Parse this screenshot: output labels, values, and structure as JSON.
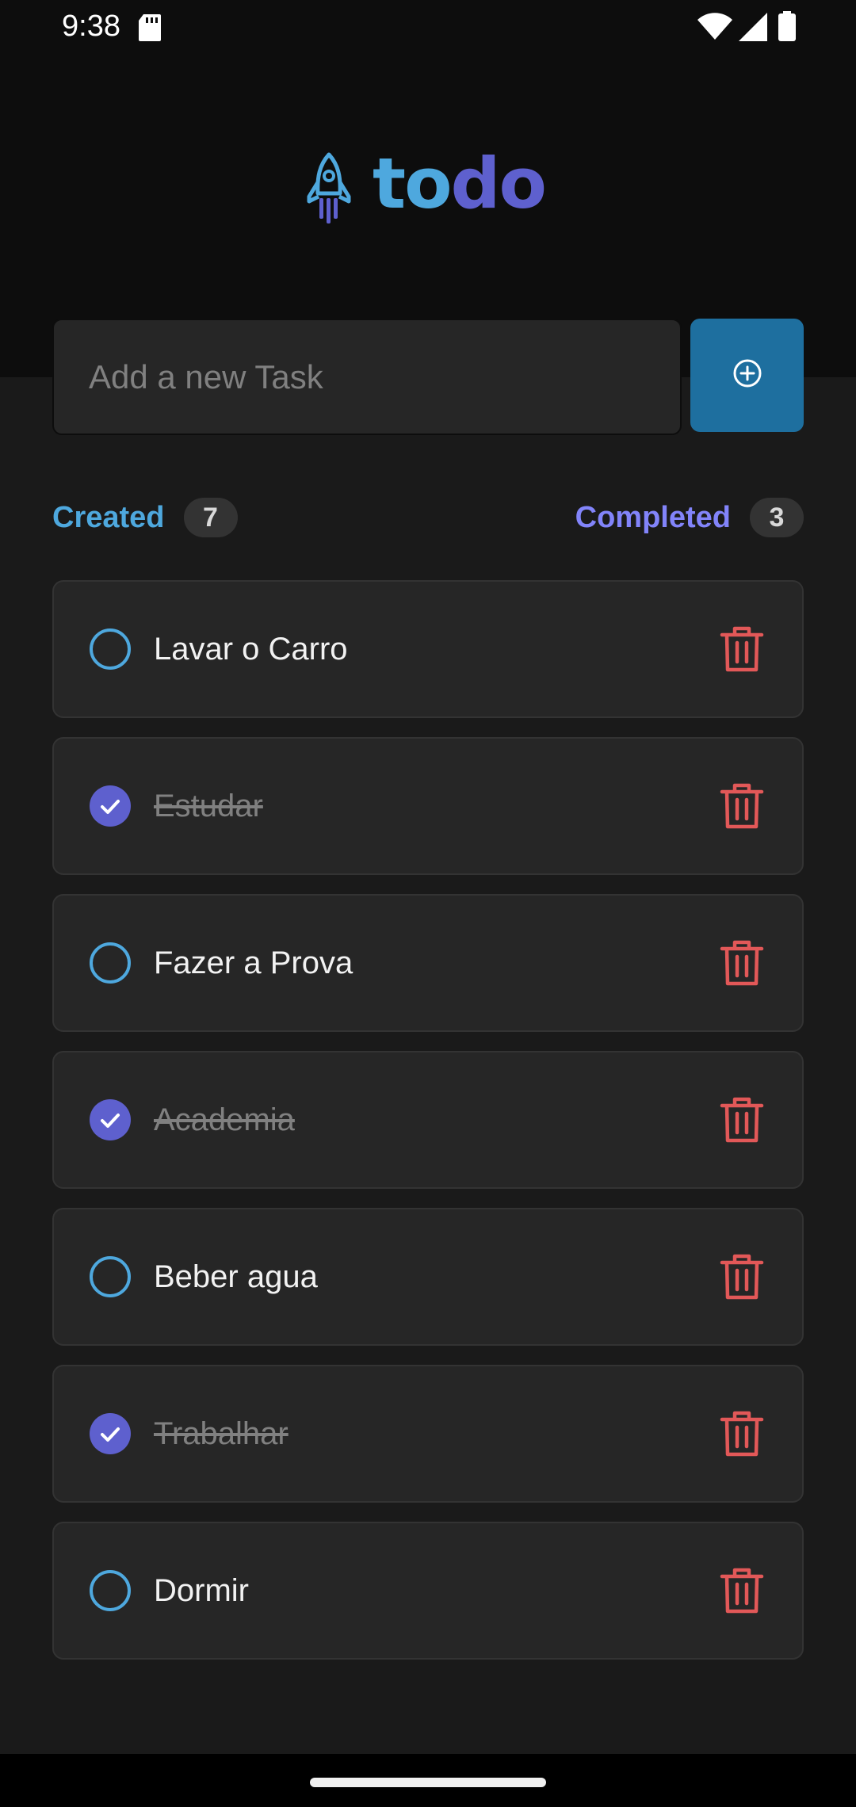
{
  "status_bar": {
    "time": "9:38",
    "icons": [
      "sd-card-icon",
      "wifi-icon",
      "signal-icon",
      "battery-icon"
    ]
  },
  "logo": {
    "icon": "rocket-icon",
    "text_part1": "to",
    "text_part2": "do"
  },
  "new_task": {
    "placeholder": "Add a new Task",
    "value": "",
    "add_button_icon": "plus-circle-icon"
  },
  "counters": {
    "created_label": "Created",
    "created_count": "7",
    "completed_label": "Completed",
    "completed_count": "3"
  },
  "tasks": [
    {
      "text": "Lavar o Carro",
      "done": false
    },
    {
      "text": "Estudar",
      "done": true
    },
    {
      "text": "Fazer a Prova",
      "done": false
    },
    {
      "text": "Academia",
      "done": true
    },
    {
      "text": "Beber agua",
      "done": false
    },
    {
      "text": "Trabalhar",
      "done": true
    },
    {
      "text": "Dormir",
      "done": false
    }
  ],
  "colors": {
    "blue": "#4ea8de",
    "blue_dark": "#1e6f9f",
    "purple": "#5e60ce",
    "purple_light": "#8284fa",
    "danger": "#e25858",
    "background": "#1a1a1a",
    "header_background": "#0d0d0d"
  }
}
